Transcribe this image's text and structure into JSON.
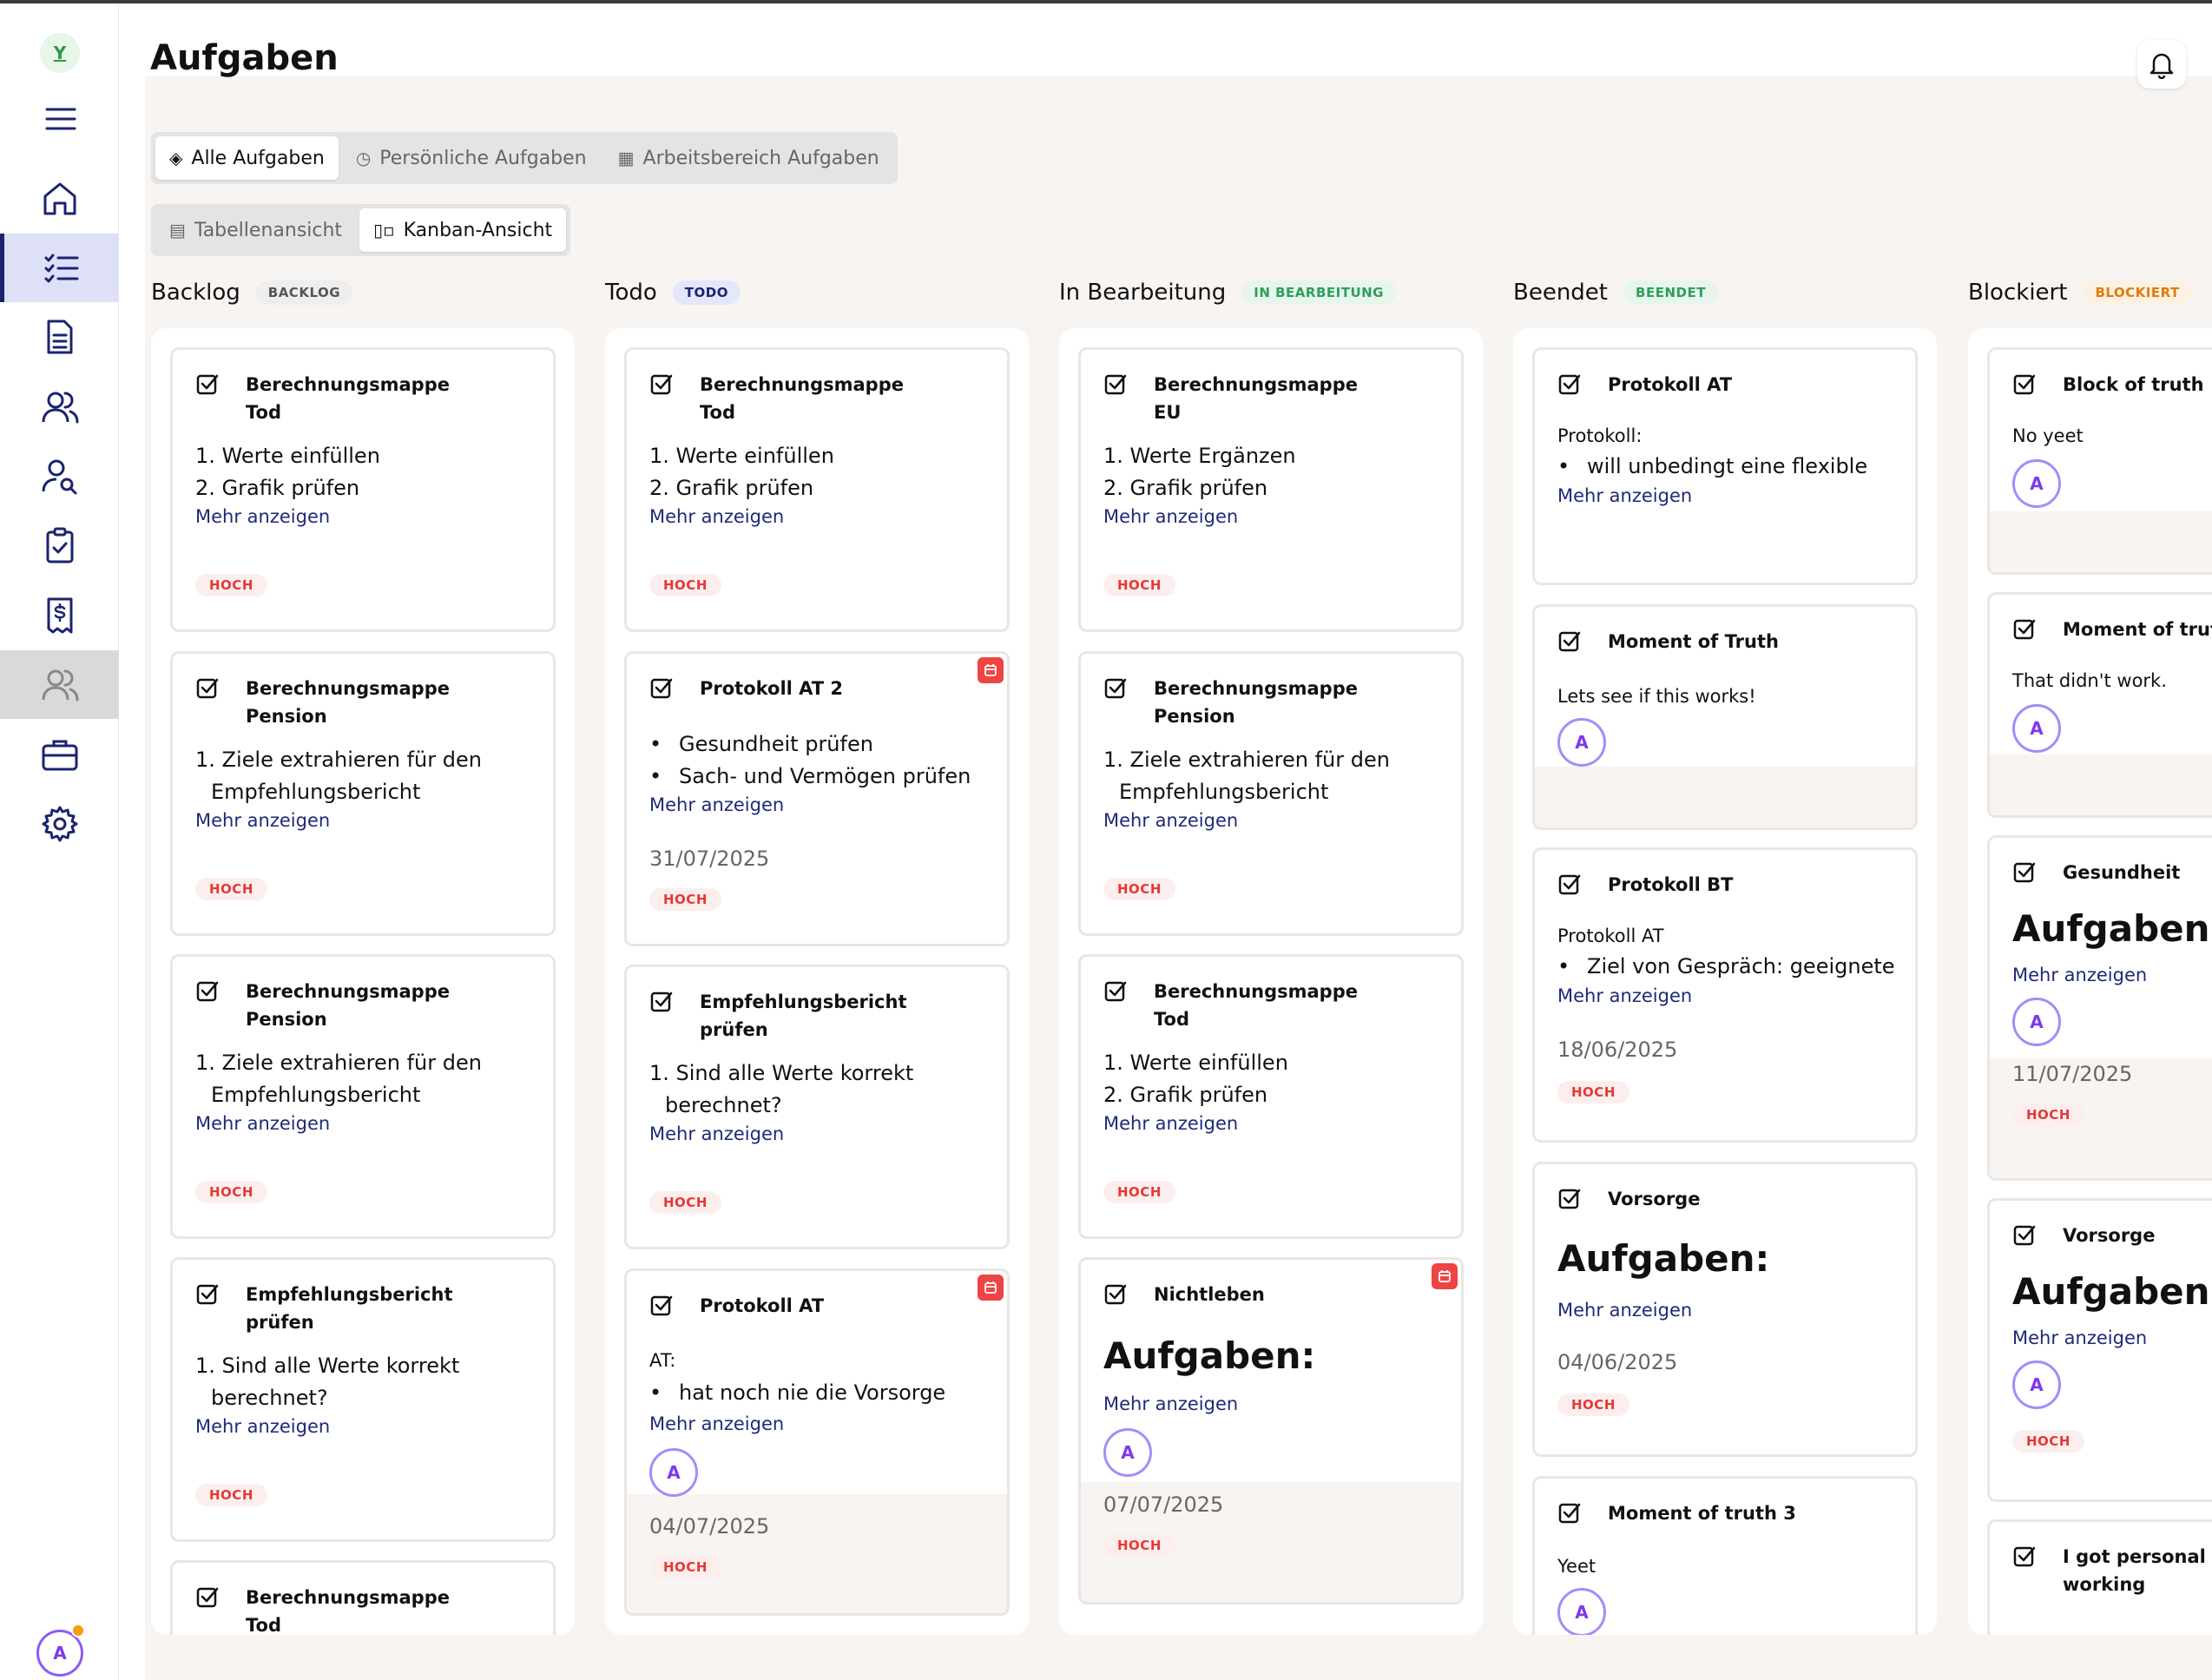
{
  "app": {
    "logo_letter": "Y",
    "user_initial": "A"
  },
  "page": {
    "title": "Aufgaben"
  },
  "filters": {
    "scope": [
      "Alle Aufgaben",
      "Persönliche Aufgaben",
      "Arbeitsbereich Aufgaben"
    ],
    "scope_selected": "Alle Aufgaben",
    "view": [
      "Tabellenansicht",
      "Kanban-Ansicht"
    ],
    "view_selected": "Kanban-Ansicht"
  },
  "labels": {
    "more": "Mehr anzeigen",
    "priority_high": "HOCH",
    "assignee": "A",
    "heading": "Aufgaben:"
  },
  "colors": {
    "accent": "#1b2370",
    "priority_high": "#e53935",
    "backlog": "#555555",
    "todo": "#3b4fd9",
    "in_progress": "#2e9e5b",
    "done": "#2e9e5b",
    "blocked": "#e07b0c"
  },
  "columns": [
    {
      "title": "Backlog",
      "badge": "BACKLOG",
      "cards": [
        {
          "title": "Berechnungsmappe Tod",
          "lines": [
            "1. Werte einfüllen",
            "2. Grafik prüfen"
          ],
          "priority": "HOCH"
        },
        {
          "title": "Berechnungsmappe Pension",
          "lines": [
            "1. Ziele extrahieren für den Empfehlungsbericht"
          ],
          "priority": "HOCH"
        },
        {
          "title": "Berechnungsmappe Pension",
          "lines": [
            "1. Ziele extrahieren für den Empfehlungsbericht"
          ],
          "priority": "HOCH"
        },
        {
          "title": "Empfehlungsbericht prüfen",
          "lines": [
            "1. Sind alle Werte korrekt berechnet?"
          ],
          "priority": "HOCH"
        },
        {
          "title": "Berechnungsmappe Tod"
        }
      ]
    },
    {
      "title": "Todo",
      "badge": "TODO",
      "cards": [
        {
          "title": "Berechnungsmappe Tod",
          "lines": [
            "1. Werte einfüllen",
            "2. Grafik prüfen"
          ],
          "priority": "HOCH"
        },
        {
          "title": "Protokoll AT 2",
          "bullets": [
            "Gesundheit prüfen",
            "Sach- und Vermögen prüfen"
          ],
          "date": "31/07/2025",
          "priority": "HOCH"
        },
        {
          "title": "Empfehlungsbericht prüfen",
          "lines": [
            "1. Sind alle Werte korrekt berechnet?"
          ],
          "priority": "HOCH"
        },
        {
          "title": "Protokoll AT",
          "intro": "AT:",
          "bullets": [
            "hat noch nie die Vorsorge"
          ],
          "date": "04/07/2025",
          "priority": "HOCH"
        }
      ]
    },
    {
      "title": "In Bearbeitung",
      "badge": "IN BEARBEITUNG",
      "cards": [
        {
          "title": "Berechnungsmappe EU",
          "lines": [
            "1. Werte Ergänzen",
            "2. Grafik prüfen"
          ],
          "priority": "HOCH"
        },
        {
          "title": "Berechnungsmappe Pension",
          "lines": [
            "1. Ziele extrahieren für den Empfehlungsbericht"
          ],
          "priority": "HOCH"
        },
        {
          "title": "Berechnungsmappe Tod",
          "lines": [
            "1. Werte einfüllen",
            "2. Grafik prüfen"
          ],
          "priority": "HOCH"
        },
        {
          "title": "Nichtleben",
          "date": "07/07/2025",
          "priority": "HOCH"
        }
      ]
    },
    {
      "title": "Beendet",
      "badge": "BEENDET",
      "cards": [
        {
          "title": "Protokoll AT",
          "intro": "Protokoll:",
          "bullets": [
            "will unbedingt eine flexible"
          ]
        },
        {
          "title": "Moment of Truth",
          "intro": "Lets see if this works!"
        },
        {
          "title": "Protokoll BT",
          "intro": "Protokoll AT",
          "bullets": [
            "Ziel von Gespräch: geeignete"
          ],
          "date": "18/06/2025",
          "priority": "HOCH"
        },
        {
          "title": "Vorsorge",
          "date": "04/06/2025",
          "priority": "HOCH"
        },
        {
          "title": "Moment of truth 3",
          "intro": "Yeet"
        }
      ]
    },
    {
      "title": "Blockiert",
      "badge": "BLOCKIERT",
      "cards": [
        {
          "title": "Block of truth",
          "intro": "No yeet"
        },
        {
          "title": "Moment of truth",
          "intro": "That didn't work."
        },
        {
          "title": "Gesundheit",
          "date": "11/07/2025",
          "priority": "HOCH"
        },
        {
          "title": "Vorsorge",
          "priority": "HOCH"
        },
        {
          "title": "I got personal working"
        }
      ]
    }
  ]
}
